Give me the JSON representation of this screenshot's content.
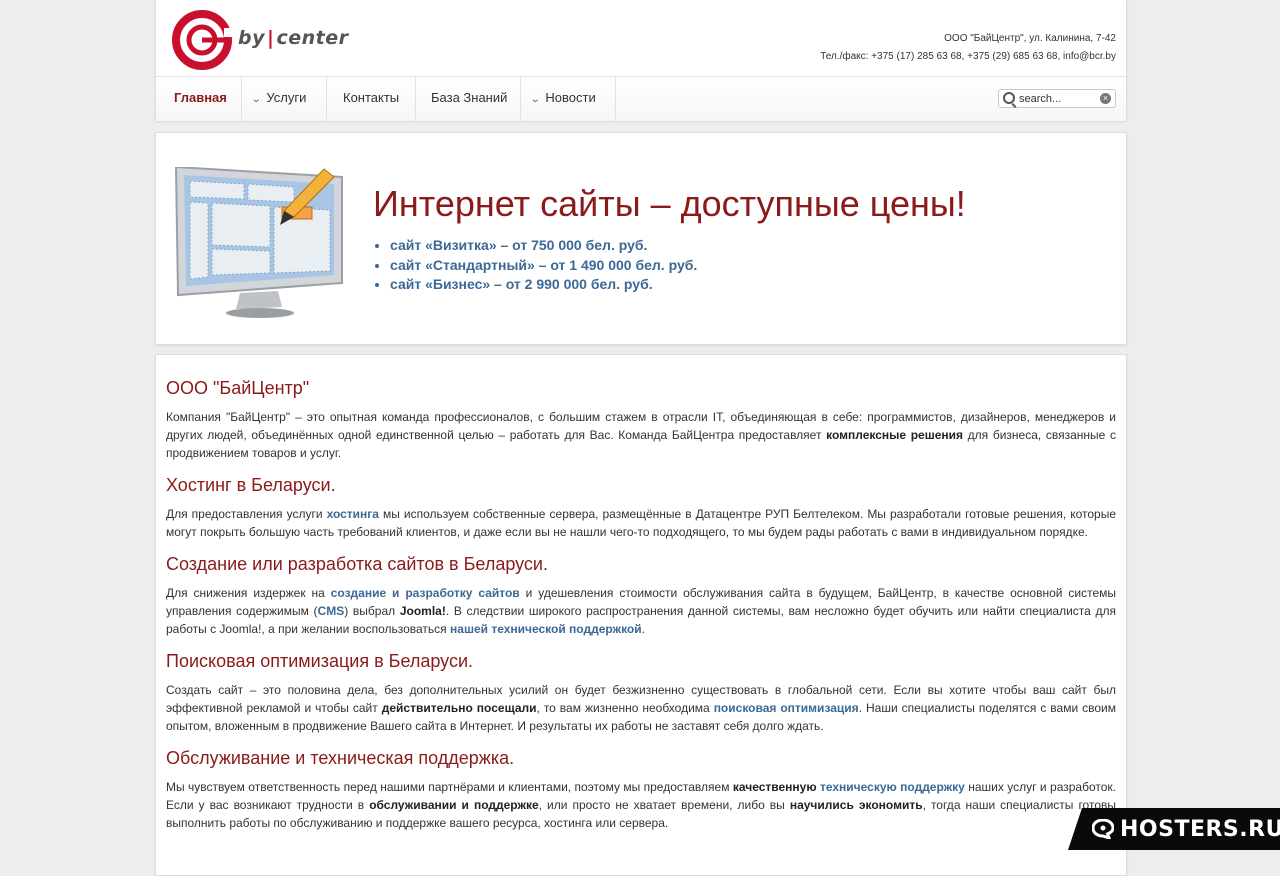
{
  "logo": {
    "text_before": "by",
    "text_after": "center"
  },
  "header": {
    "address": "ООО \"БайЦентр\", ул. Калинина, 7-42",
    "phone": "Тел./факс: +375 (17) 285 63 68, +375 (29) 685 63 68, info@bcr.by"
  },
  "nav": {
    "items": [
      {
        "label": "Главная"
      },
      {
        "label": "Услуги"
      },
      {
        "label": "Контакты"
      },
      {
        "label": "База Знаний"
      },
      {
        "label": "Новости"
      }
    ],
    "search_placeholder": "search..."
  },
  "banner": {
    "title": "Интернет сайты – доступные цены!",
    "items": [
      "сайт «Визитка» – от 750 000 бел. руб.",
      "сайт «Стандартный» – от 1 490 000 бел. руб.",
      "сайт «Бизнес» – от 2 990 000 бел. руб."
    ]
  },
  "content": {
    "s1": {
      "heading": "ООО \"БайЦентр\"",
      "t1": "Компания \"БайЦентр\" – это опытная команда профессионалов, с большим стажем в отрасли IT, объединяющая в себе: программистов, дизайнеров, менеджеров и других людей, объединённых одной единственной целью – работать для Вас. Команда БайЦентра предоставляет ",
      "b1": "комплексные решения",
      "t2": " для бизнеса, связанные с продвижением товаров и услуг."
    },
    "s2": {
      "heading": "Хостинг в Беларуси.",
      "t1": "Для предоставления услуги ",
      "a1": "хостинга",
      "t2": " мы используем собственные сервера, размещённые в Датацентре РУП Белтелеком. Мы разработали готовые решения, которые могут покрыть большую часть требований клиентов, и даже если вы не нашли чего-то подходящего, то мы будем рады работать с вами в индивидуальном порядке."
    },
    "s3": {
      "heading": "Создание или разработка сайтов в Беларуси.",
      "t1": "Для снижения издержек на ",
      "a1": "создание и разработку сайтов",
      "t2": " и удешевления стоимости обслуживания сайта в будущем, БайЦентр, в качестве основной системы управления содержимым (",
      "a2": "CMS",
      "t3": ") выбрал ",
      "b1": "Joomla!",
      "t4": ". В следствии широкого распространения данной системы, вам несложно будет обучить или найти специалиста для работы с Joomla!, а при желании воспользоваться ",
      "a3": "нашей технической поддержкой",
      "t5": "."
    },
    "s4": {
      "heading": "Поисковая оптимизация в Беларуси.",
      "t1": "Создать сайт – это половина дела, без дополнительных усилий он будет безжизненно существовать в глобальной сети. Если вы хотите чтобы ваш сайт был эффективной рекламой и чтобы сайт ",
      "b1": "действительно посещали",
      "t2": ",  то вам жизненно необходима ",
      "a1": "поисковая оптимизация",
      "t3": ". Наши специалисты поделятся с вами своим опытом, вложенным в продвижение Вашего сайта в Интернет. И результаты их работы не заставят себя долго ждать."
    },
    "s5": {
      "heading": "Обслуживание и техническая поддержка.",
      "t1": "Мы чувствуем ответственность перед нашими партнёрами и клиентами, поэтому мы предоставляем ",
      "b1": "качественную",
      "t2": " ",
      "a1": "техническую поддержку",
      "t3": " наших услуг и разработок. Если у вас возникают трудности в ",
      "b2": "обслуживании и поддержке",
      "t4": ", или просто не хватает времени, либо вы ",
      "b3": "научились экономить",
      "t5": ", тогда наши специалисты готовы выполнить работы по обслуживанию и поддержке вашего ресурса, хостинга или сервера."
    }
  },
  "watermark": {
    "text": "HOSTERS.RU"
  },
  "colors": {
    "heading": "#8b1a1a",
    "link": "#3b6996",
    "brand_red": "#c8102e"
  }
}
